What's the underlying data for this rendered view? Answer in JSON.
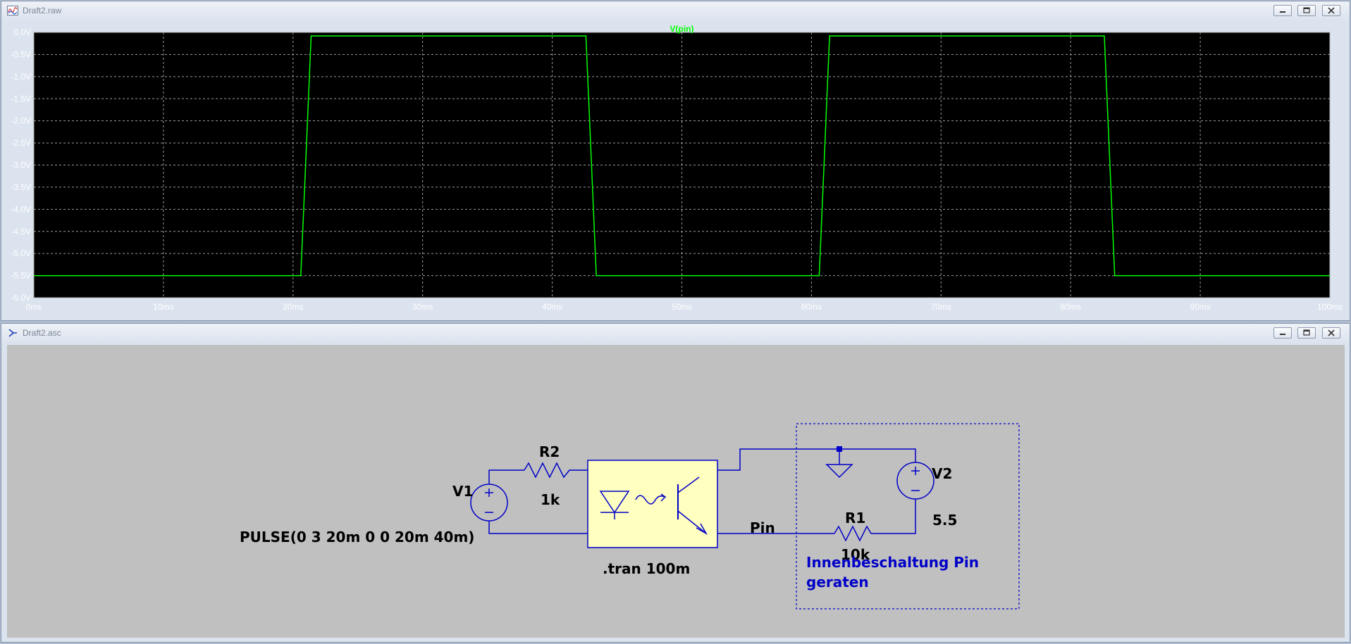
{
  "plot_window": {
    "title": "Draft2.raw",
    "trace_label": "V(pin)",
    "colors": {
      "trace": "#00ff00",
      "background": "#000000",
      "axis_text": "#ffffff",
      "grid": "#9a9a9a"
    }
  },
  "schematic_window": {
    "title": "Draft2.asc",
    "components": {
      "v1_name": "V1",
      "v1_value": "PULSE(0 3 20m 0 0 20m 40m)",
      "r2_name": "R2",
      "r2_value": "1k",
      "v2_name": "V2",
      "v2_value": "5.5",
      "r1_name": "R1",
      "r1_value": "10k",
      "net_label": "Pin"
    },
    "directive": ".tran 100m",
    "comment_line1": "Innenbeschaltung Pin",
    "comment_line2": "geraten",
    "colors": {
      "wire": "#0000c8",
      "background": "#c0c0c0",
      "optocoupler_fill": "#ffffc0"
    }
  },
  "chart_data": {
    "type": "line",
    "title": "V(pin)",
    "xlabel": "",
    "ylabel": "",
    "x_ticks": [
      "0ms",
      "10ms",
      "20ms",
      "30ms",
      "40ms",
      "50ms",
      "60ms",
      "70ms",
      "80ms",
      "90ms",
      "100ms"
    ],
    "y_ticks": [
      "0.0V",
      "-0.5V",
      "-1.0V",
      "-1.5V",
      "-2.0V",
      "-2.5V",
      "-3.0V",
      "-3.5V",
      "-4.0V",
      "-4.5V",
      "-5.0V",
      "-5.5V",
      "-6.0V"
    ],
    "xlim": [
      0,
      100
    ],
    "ylim": [
      -6.0,
      0.0
    ],
    "grid": true,
    "series": [
      {
        "name": "V(pin)",
        "x_ms": [
          0,
          20.6,
          21.0,
          21.4,
          42.6,
          43.0,
          43.4,
          60.6,
          61.0,
          61.4,
          82.6,
          83.0,
          83.4,
          100
        ],
        "y_v": [
          -5.5,
          -5.5,
          -2.8,
          -0.08,
          -0.08,
          -2.8,
          -5.5,
          -5.5,
          -2.8,
          -0.08,
          -0.08,
          -2.8,
          -5.5,
          -5.5
        ]
      }
    ]
  }
}
